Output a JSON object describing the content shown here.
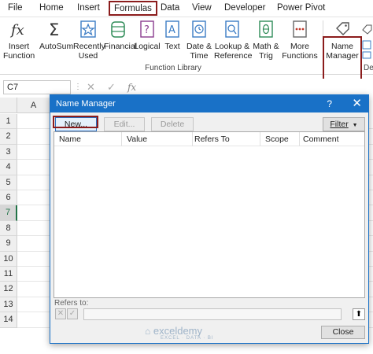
{
  "ribbon": {
    "tabs": [
      "File",
      "Home",
      "Insert",
      "Formulas",
      "Data",
      "View",
      "Developer",
      "Power Pivot"
    ],
    "buttons": [
      {
        "line1": "Insert",
        "line2": "Function",
        "icon": "fx-icon"
      },
      {
        "line1": "AutoSum",
        "line2": "",
        "icon": "sigma-icon"
      },
      {
        "line1": "Recently",
        "line2": "Used",
        "icon": "star-icon"
      },
      {
        "line1": "Financial",
        "line2": "",
        "icon": "database-icon"
      },
      {
        "line1": "Logical",
        "line2": "",
        "icon": "question-icon"
      },
      {
        "line1": "Text",
        "line2": "",
        "icon": "text-icon"
      },
      {
        "line1": "Date &",
        "line2": "Time",
        "icon": "clock-icon"
      },
      {
        "line1": "Lookup &",
        "line2": "Reference",
        "icon": "magnifier-icon"
      },
      {
        "line1": "Math &",
        "line2": "Trig",
        "icon": "theta-icon"
      },
      {
        "line1": "More",
        "line2": "Functions",
        "icon": "more-icon"
      },
      {
        "line1": "Name",
        "line2": "Manager",
        "icon": "tag-icon"
      }
    ],
    "group_label": "Function Library",
    "group_label_partial": "De"
  },
  "formula_bar": {
    "name_box": "C7",
    "icons": [
      "cancel-icon",
      "enter-icon",
      "fx-icon"
    ]
  },
  "grid": {
    "column_headers": [
      "A"
    ],
    "row_numbers": [
      "1",
      "2",
      "3",
      "4",
      "5",
      "6",
      "7",
      "8",
      "9",
      "10",
      "11",
      "12",
      "13",
      "14"
    ],
    "selected_row": "7"
  },
  "dialog": {
    "title": "Name Manager",
    "help_icon": "?",
    "close_icon": "✕",
    "new_label": "New...",
    "edit_label": "Edit...",
    "delete_label": "Delete",
    "filter_label": "Filter",
    "columns": [
      "Name",
      "Value",
      "Refers To",
      "Scope",
      "Comment"
    ],
    "refers_to_label": "Refers to:",
    "close_label": "Close"
  },
  "watermark": {
    "brand": "exceldemy",
    "tagline": "EXCEL · DATA · BI"
  },
  "colors": {
    "title_bar": "#1971c7",
    "highlight": "#8b1c1c",
    "excel_green": "#217346"
  }
}
